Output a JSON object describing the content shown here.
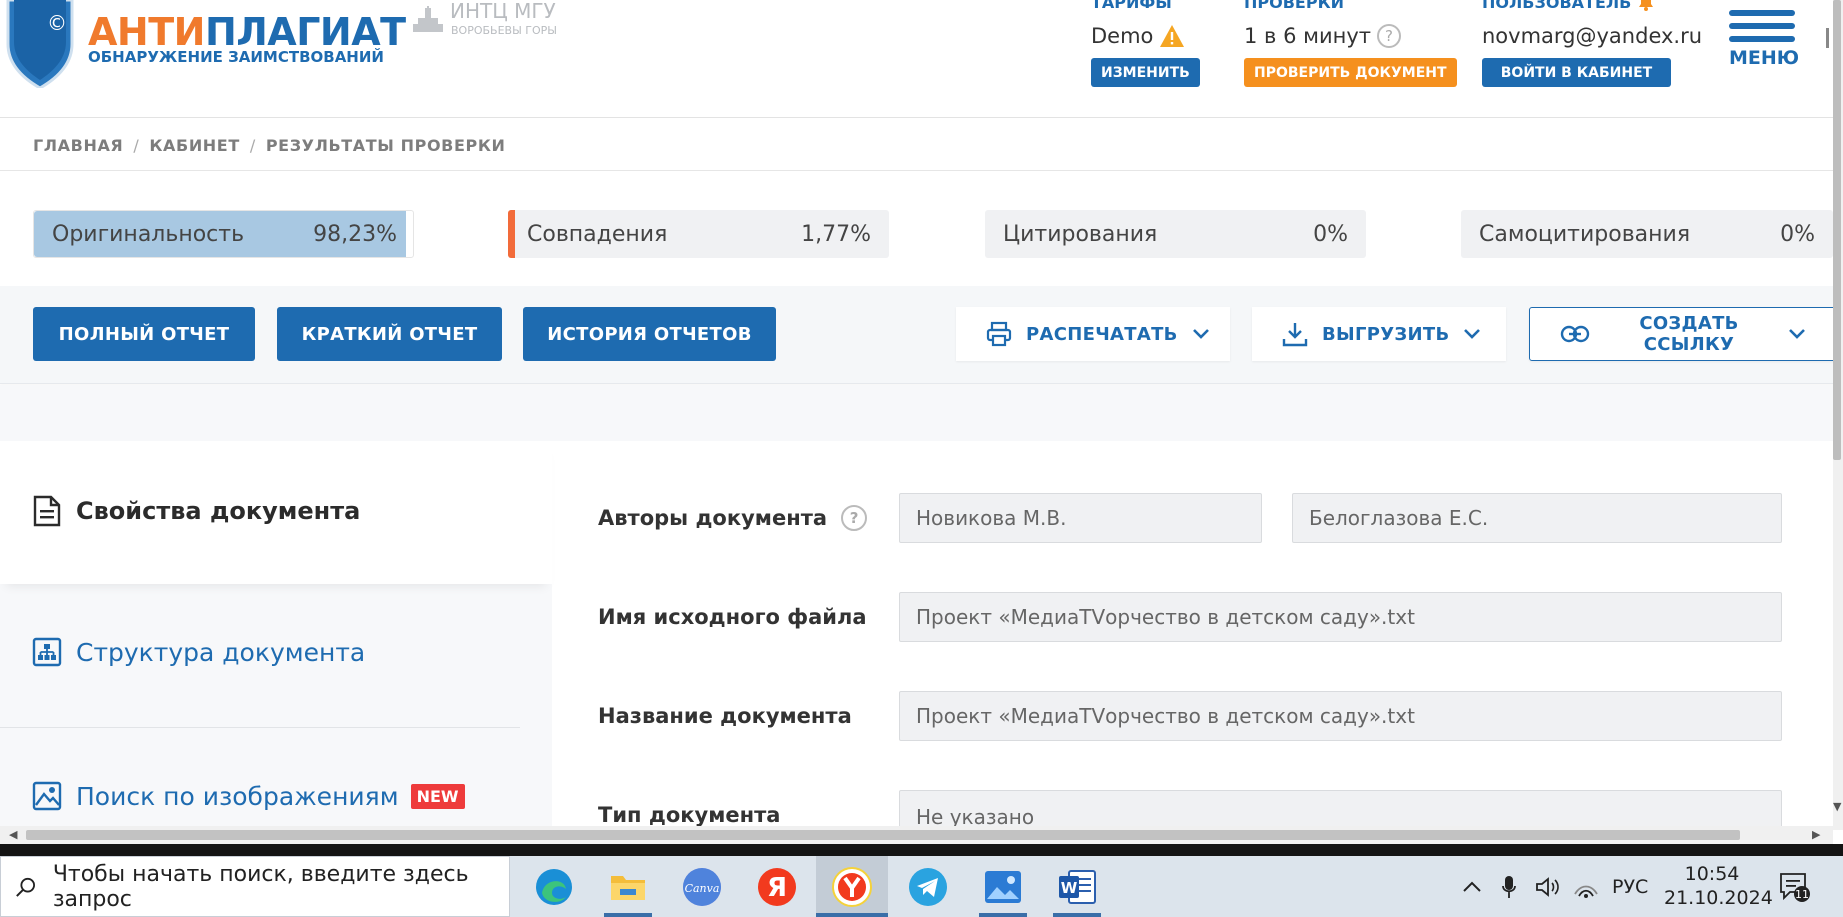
{
  "header": {
    "logo_part1": "АНТИ",
    "logo_part2": "ПЛАГИАТ",
    "logo_subtitle": "ОБНАРУЖЕНИЕ ЗАИМСТВОВАНИЙ",
    "logo_symbol": "©",
    "partner_name": "ИНТЦ МГУ",
    "partner_sub": "ВОРОБЬЕВЫ ГОРЫ",
    "tariffs": {
      "label": "ТАРИФЫ",
      "value": "Demo",
      "button": "ИЗМЕНИТЬ"
    },
    "checks": {
      "label": "ПРОВЕРКИ",
      "value": "1 в 6 минут",
      "help": "?",
      "button": "ПРОВЕРИТЬ ДОКУМЕНТ"
    },
    "user": {
      "label": "ПОЛЬЗОВАТЕЛЬ",
      "email": "novmarg@yandex.ru",
      "button": "ВОЙТИ В КАБИНЕТ"
    },
    "menu_label": "МЕНЮ"
  },
  "breadcrumb": [
    "ГЛАВНАЯ",
    "КАБИНЕТ",
    "РЕЗУЛЬТАТЫ ПРОВЕРКИ"
  ],
  "breadcrumb_sep": "/",
  "stats": {
    "originality": {
      "label": "Оригинальность",
      "value": "98,23%",
      "fraction": 0.9823
    },
    "matches": {
      "label": "Совпадения",
      "value": "1,77%"
    },
    "citations": {
      "label": "Цитирования",
      "value": "0%"
    },
    "self_citations": {
      "label": "Самоцитирования",
      "value": "0%"
    }
  },
  "actions": {
    "full_report": "ПОЛНЫЙ ОТЧЕТ",
    "short_report": "КРАТКИЙ ОТЧЕТ",
    "report_history": "ИСТОРИЯ ОТЧЕТОВ",
    "print": "РАСПЕЧАТАТЬ",
    "export": "ВЫГРУЗИТЬ",
    "create_link": "СОЗДАТЬ ССЫЛКУ"
  },
  "left_nav": {
    "properties": "Свойства документа",
    "structure": "Структура документа",
    "image_search": "Поиск по изображениям",
    "new_badge": "NEW"
  },
  "properties": {
    "authors_label": "Авторы документа",
    "authors_help": "?",
    "author1": "Новикова М.В.",
    "author2": "Белоглазова Е.С.",
    "filename_label": "Имя исходного файла",
    "filename": "Проект «МедиаТVорчество в детском саду».txt",
    "title_label": "Название документа",
    "title": "Проект «МедиаТVорчество в детском саду».txt",
    "type_label": "Тип документа",
    "type": "Не указано"
  },
  "taskbar": {
    "search_placeholder": "Чтобы начать поиск, введите здесь запрос",
    "apps": [
      "edge-icon",
      "file-explorer-icon",
      "canva-icon",
      "yandex-icon",
      "yandex-browser-icon",
      "telegram-icon",
      "photos-icon",
      "word-icon"
    ],
    "canva_label": "Canva",
    "yandex_label": "Я",
    "word_label": "W",
    "language": "РУС",
    "time": "10:54",
    "date": "21.10.2024",
    "notifications": "11"
  },
  "colors": {
    "brand_blue": "#1e6bb0",
    "brand_orange": "#f07a2d",
    "match_orange": "#f26b3a",
    "orig_fill": "#a8c8e2"
  }
}
